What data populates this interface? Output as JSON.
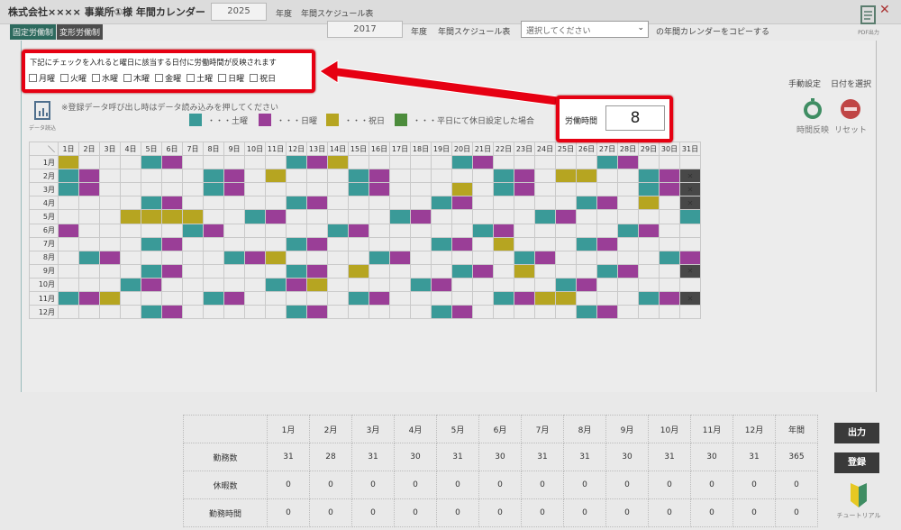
{
  "app_title": "株式会社×××× 事業所①様 年間カレンダー",
  "year": "2025",
  "year_unit": "年度",
  "schedule_label": "年間スケジュール表",
  "copy": {
    "year": "2017",
    "year_unit": "年度",
    "schedule_label": "年間スケジュール表",
    "select_placeholder": "選択してください",
    "copy_suffix": "の年間カレンダーをコピーする"
  },
  "tabs": [
    "固定労働制",
    "変形労働制"
  ],
  "callout": {
    "text": "下記にチェックを入れると曜日に該当する日付に労働時間が反映されます",
    "days": [
      "月曜",
      "火曜",
      "水曜",
      "木曜",
      "金曜",
      "土曜",
      "日曜",
      "祝日"
    ]
  },
  "labor": {
    "label": "労働時間",
    "value": "8"
  },
  "notice": "※登録データ呼び出し時はデータ読み込みを押してください",
  "data_read_label": "データ読込",
  "manual_setting": "手動設定",
  "date_select": "日付を選択",
  "time_reflect": "時間反映",
  "reset": "リセット",
  "legend": [
    {
      "label": "・・・土曜",
      "color": "#3a9a98"
    },
    {
      "label": "・・・日曜",
      "color": "#9a3e97"
    },
    {
      "label": "・・・祝日",
      "color": "#b6a521"
    },
    {
      "label": "・・・平日にて休日設定した場合",
      "color": "#4c8c3c"
    }
  ],
  "calendar": {
    "corner": "＼",
    "days": [
      "1日",
      "2日",
      "3日",
      "4日",
      "5日",
      "6日",
      "7日",
      "8日",
      "9日",
      "10日",
      "11日",
      "12日",
      "13日",
      "14日",
      "15日",
      "16日",
      "17日",
      "18日",
      "19日",
      "20日",
      "21日",
      "22日",
      "23日",
      "24日",
      "25日",
      "26日",
      "27日",
      "28日",
      "29日",
      "30日",
      "31日"
    ],
    "months": [
      "1月",
      "2月",
      "3月",
      "4月",
      "5月",
      "6月",
      "7月",
      "8月",
      "9月",
      "10月",
      "11月",
      "12月"
    ],
    "colors": [
      "o...tm.....tmo.....tm.....tm...",
      "tm.....tm.o...tm.....tm.oo..tmxxx",
      "tm.....tm.....tm...o.tm.....tmx",
      "....tm.....tm.....tm.....tm.o.x",
      "...oooo..tm.....tm.....tm.....t",
      "m.....tm.....tm.....tm.....tm..",
      "....tm.....tm.....tm.o...tm....",
      ".tm.....tmo....tm.....tm.....tm",
      "....tm.....tm.o....tm.o...tm..x",
      "...tm.....tmo....tm.....tm.....",
      "tmo....tm.....tm.....tmoo...tmx",
      "....tm.....tm.....tm.....tm...."
    ],
    "x_mark": "✕"
  },
  "stats": {
    "months": [
      "1月",
      "2月",
      "3月",
      "4月",
      "5月",
      "6月",
      "7月",
      "8月",
      "9月",
      "10月",
      "11月",
      "12月",
      "年間"
    ],
    "rows": [
      {
        "label": "勤務数",
        "values": [
          "31",
          "28",
          "31",
          "30",
          "31",
          "30",
          "31",
          "31",
          "30",
          "31",
          "30",
          "31",
          "365"
        ]
      },
      {
        "label": "休暇数",
        "values": [
          "0",
          "0",
          "0",
          "0",
          "0",
          "0",
          "0",
          "0",
          "0",
          "0",
          "0",
          "0",
          "0"
        ]
      },
      {
        "label": "勤務時間",
        "values": [
          "0",
          "0",
          "0",
          "0",
          "0",
          "0",
          "0",
          "0",
          "0",
          "0",
          "0",
          "0",
          "0"
        ]
      }
    ]
  },
  "buttons": {
    "output": "出力",
    "register": "登録"
  },
  "tutorial": "チュートリアル",
  "pdf_label": "PDF出力"
}
